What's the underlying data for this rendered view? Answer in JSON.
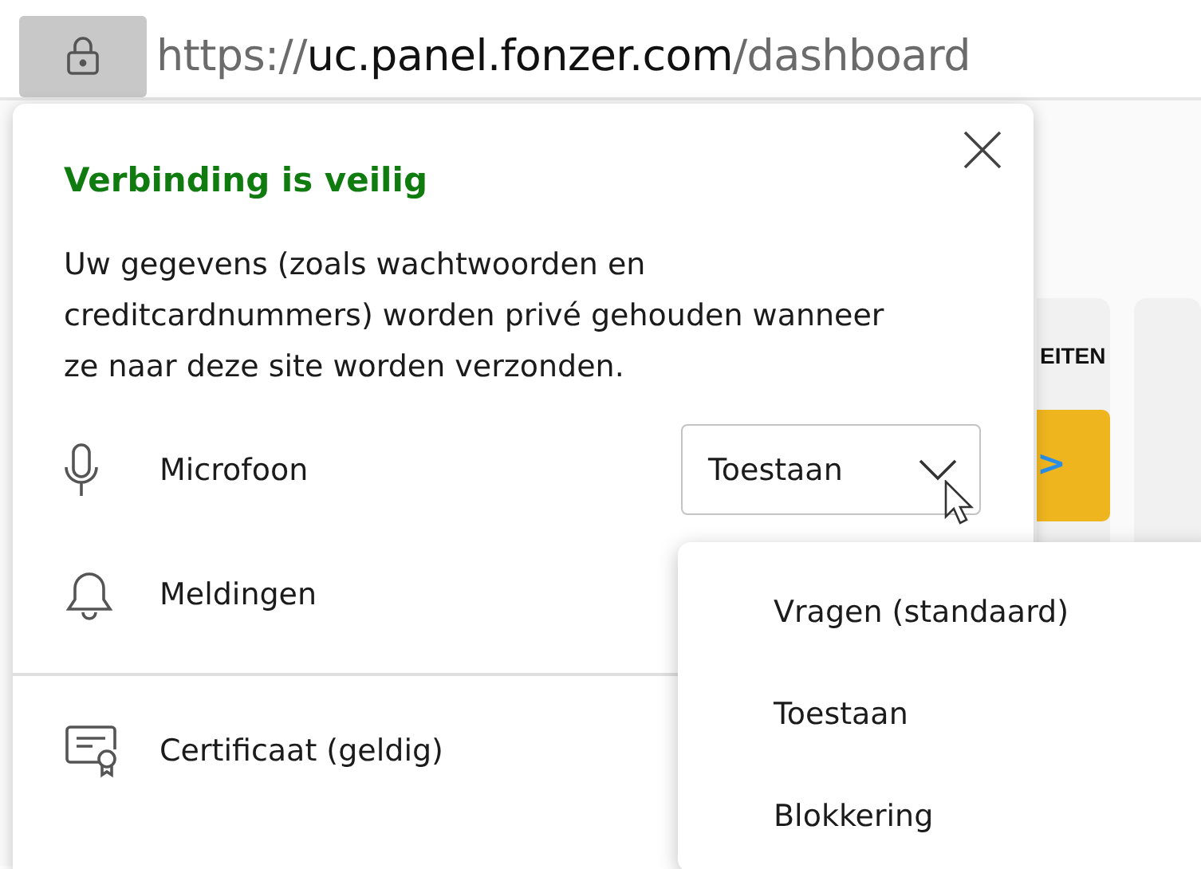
{
  "address_bar": {
    "scheme": "https://",
    "host": "uc.panel.fonzer.com",
    "path": "/dashboard"
  },
  "background_page": {
    "card_heading": "EITEN",
    "arrow": ">"
  },
  "site_info_popup": {
    "title": "Verbinding is veilig",
    "description": "Uw gegevens (zoals wachtwoorden en creditcardnummers) worden privé gehouden wanneer ze naar deze site worden verzonden.",
    "permissions": [
      {
        "kind": "microphone",
        "label": "Microfoon",
        "value": "Toestaan",
        "open": true
      },
      {
        "kind": "notifications",
        "label": "Meldingen"
      }
    ],
    "certificate": {
      "label": "Certificaat (geldig)"
    }
  },
  "dropdown_options": [
    {
      "label": "Vragen (standaard)"
    },
    {
      "label": "Toestaan"
    },
    {
      "label": "Blokkering"
    }
  ]
}
